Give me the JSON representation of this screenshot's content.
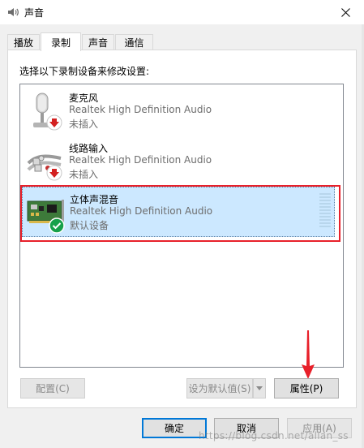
{
  "window": {
    "title": "声音"
  },
  "tabs": [
    {
      "label": "播放",
      "active": false
    },
    {
      "label": "录制",
      "active": true
    },
    {
      "label": "声音",
      "active": false
    },
    {
      "label": "通信",
      "active": false
    }
  ],
  "panel": {
    "instruction": "选择以下录制设备来修改设置:"
  },
  "devices": [
    {
      "name": "麦克风",
      "driver": "Realtek High Definition Audio",
      "status": "未插入",
      "icon": "microphone-icon",
      "badge": "unplugged-badge-icon",
      "selected": false
    },
    {
      "name": "线路输入",
      "driver": "Realtek High Definition Audio",
      "status": "未插入",
      "icon": "line-in-cable-icon",
      "badge": "unplugged-badge-icon",
      "selected": false
    },
    {
      "name": "立体声混音",
      "driver": "Realtek High Definition Audio",
      "status": "默认设备",
      "icon": "sound-card-icon",
      "badge": "default-check-icon",
      "selected": true
    }
  ],
  "buttons": {
    "configure": "配置(C)",
    "set_default": "设为默认值(S)",
    "properties": "属性(P)",
    "ok": "确定",
    "cancel": "取消",
    "apply": "应用(A)"
  },
  "watermark": "https://blog.csdn.net/allan_ss",
  "colors": {
    "selection": "#cce8ff",
    "annotation": "#e8202a",
    "default_button_border": "#0078d7",
    "check": "#16a04a",
    "unplugged": "#d32020"
  }
}
